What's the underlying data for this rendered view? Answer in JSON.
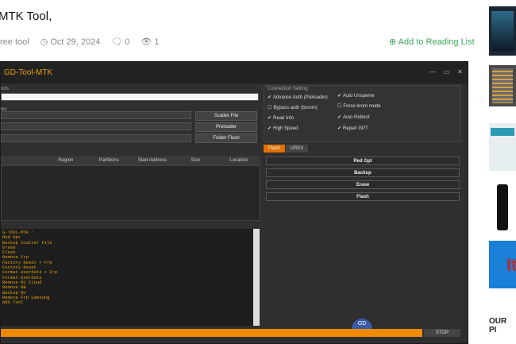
{
  "article": {
    "title": "MTK Tool,",
    "category": "ree tool",
    "date": "Oct 29, 2024",
    "comments": "0",
    "views": "1",
    "reading_list": "Add to Reading List"
  },
  "app": {
    "title": "GD-Tool-MTK",
    "labels": {
      "ports": "orts",
      "files": "les",
      "connection": "Connection Setting"
    },
    "buttons": [
      "Scatter File",
      "Preloader",
      "Folder Flash"
    ],
    "table_headers": [
      "",
      "Region",
      "Partitions",
      "Start Address",
      "Size",
      "Location"
    ],
    "options": [
      "Advance Auth (Preloader)",
      "Auto Unspeme",
      "Bypass auth (bsrom)",
      "Force brom mode",
      "Read Info",
      "Auto Reboot",
      "High Speed",
      "Repair GPT"
    ],
    "tabs": [
      "Flash",
      "UREX"
    ],
    "actions": [
      "Red Gpt",
      "Backup",
      "Erase",
      "Flash"
    ],
    "log_lines": [
      "G-TOOL-MTK :",
      "Red Gpt",
      "Backup Scatter File",
      "Erase",
      "Flash",
      "Remove Frp",
      "Factory Reset + Frp",
      "Factory Reset",
      "Format Userdata + Frp",
      "Format Userdata",
      "Remove Mi Cloud",
      "Remove RB",
      "Backup NV",
      "Remove Frp Samsung",
      "ADS Tool"
    ],
    "stop": "STOP",
    "badge": "GD",
    "progress": 0.9
  },
  "sidebar": {
    "heading": "OUR PI",
    "ad_text": "It"
  },
  "colors": {
    "accent": "#e8a200",
    "orange": "#f08a00",
    "green": "#3aa757"
  }
}
